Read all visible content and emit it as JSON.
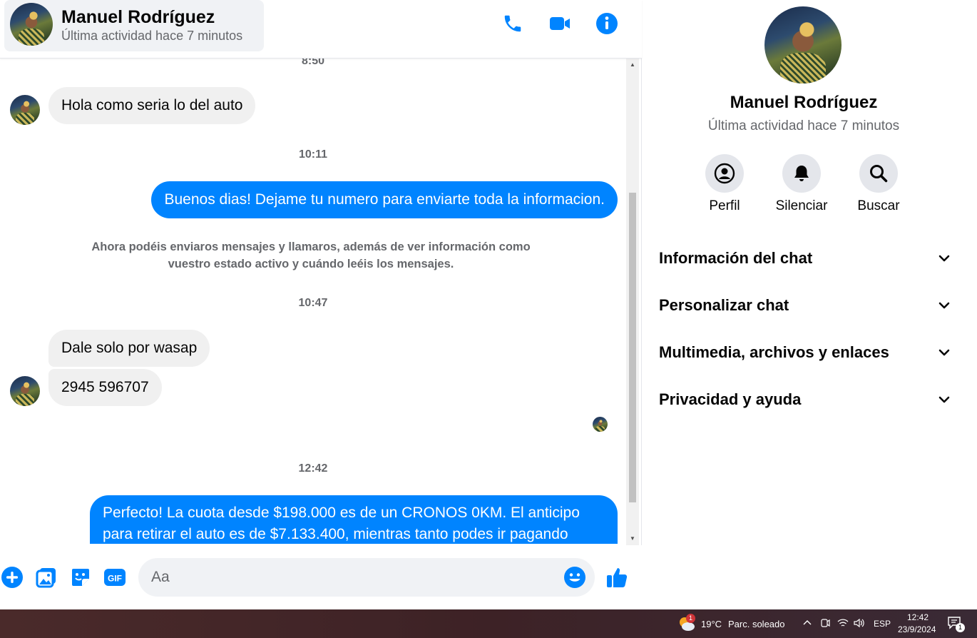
{
  "contact": {
    "name": "Manuel Rodríguez",
    "status": "Última actividad hace 7 minutos"
  },
  "header": {
    "icons": [
      "phone-icon",
      "video-icon",
      "info-icon"
    ]
  },
  "messages": {
    "timestamps": [
      "8:50",
      "10:11",
      "10:47",
      "12:42"
    ],
    "msg1": "Hola como seria lo del auto",
    "msg2": "Buenos dias! Dejame tu numero para enviarte toda la informacion.",
    "notice": "Ahora podéis enviaros mensajes y llamaros, además de ver información como vuestro estado activo y cuándo leéis los mensajes.",
    "msg3": "Dale solo por wasap",
    "msg4": "2945 596707",
    "msg5_line1": "Perfecto! La cuota desde $198.000 es de un CRONOS 0KM. El anticipo",
    "msg5_line2": "para retirar el auto es de $7.133.400, mientras tanto podes ir pagando"
  },
  "composer": {
    "placeholder": "Aa",
    "icons": [
      "plus-icon",
      "image-icon",
      "sticker-icon",
      "gif-icon",
      "emoji-icon",
      "like-icon"
    ]
  },
  "panel": {
    "actions": [
      {
        "label": "Perfil",
        "icon": "profile-icon"
      },
      {
        "label": "Silenciar",
        "icon": "bell-icon"
      },
      {
        "label": "Buscar",
        "icon": "search-icon"
      }
    ],
    "sections": [
      "Información del chat",
      "Personalizar chat",
      "Multimedia, archivos y enlaces",
      "Privacidad y ayuda"
    ]
  },
  "taskbar": {
    "weather": "19°C",
    "weather_desc": "Parc. soleado",
    "weather_badge": "1",
    "language": "ESP",
    "time": "12:42",
    "date": "23/9/2024",
    "notification_count": "1"
  },
  "colors": {
    "accent": "#0084ff",
    "bubble_in": "#f0f0f0",
    "secondary_text": "#65676b"
  }
}
